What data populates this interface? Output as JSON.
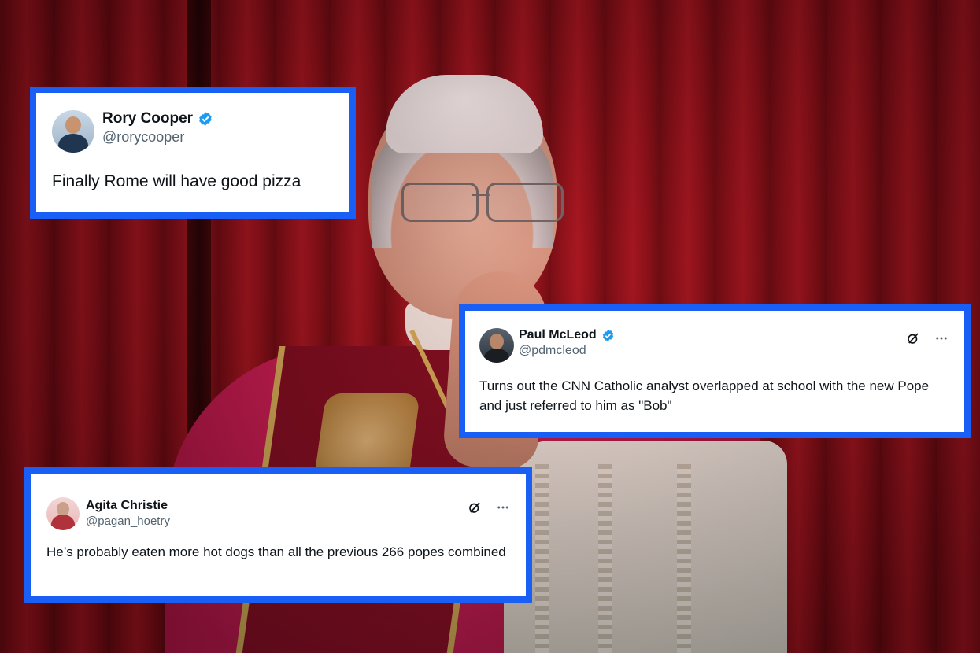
{
  "tweets": [
    {
      "name": "Rory Cooper",
      "handle": "@rorycooper",
      "verified": true,
      "text": "Finally Rome will have good pizza",
      "avatar_icon": "profile-photo-icon"
    },
    {
      "name": "Paul McLeod",
      "handle": "@pdmcleod",
      "verified": true,
      "text": "Turns out the CNN Catholic analyst overlapped at school with the new Pope and just referred to him as \"Bob\"",
      "avatar_icon": "profile-photo-icon",
      "tools": [
        "grok-icon",
        "more-options-icon"
      ]
    },
    {
      "name": "Agita Christie",
      "handle": "@pagan_hoetry",
      "verified": false,
      "text": "He’s probably eaten more hot dogs than all the previous 266 popes combined",
      "avatar_icon": "profile-photo-icon",
      "tools": [
        "grok-icon",
        "more-options-icon"
      ]
    }
  ],
  "colors": {
    "card_border": "#1a5ff5",
    "verified_badge": "#1d9bf0",
    "handle_text": "#536471",
    "background_curtain": "#8c0f19"
  }
}
